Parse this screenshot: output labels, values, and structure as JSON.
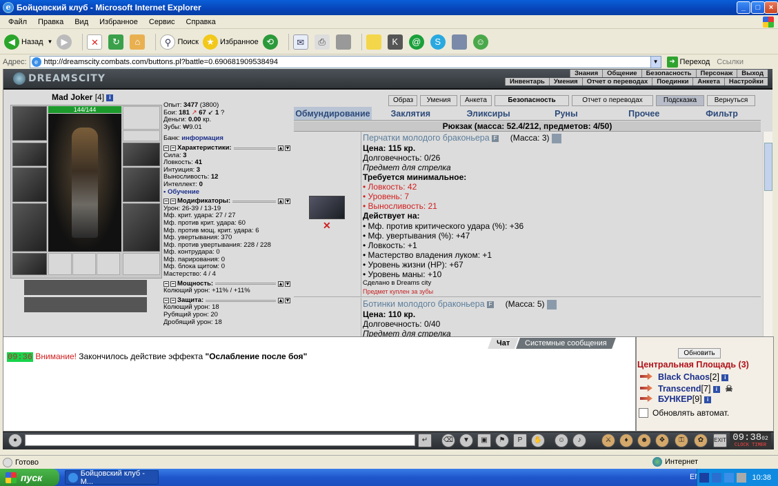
{
  "window": {
    "title": "Бойцовский клуб - Microsoft Internet Explorer"
  },
  "menu": [
    "Файл",
    "Правка",
    "Вид",
    "Избранное",
    "Сервис",
    "Справка"
  ],
  "toolbar": {
    "back": "Назад",
    "search": "Поиск",
    "favorites": "Избранное"
  },
  "address": {
    "label": "Адрес:",
    "url": "http://dreamscity.combats.com/buttons.pl?battle=0.690681909538494",
    "go": "Переход",
    "links": "Ссылки"
  },
  "game": {
    "logo": "DREAMSCITY",
    "nav_top": [
      "Знания",
      "Общение",
      "Безопасность",
      "Персонаж",
      "Выход"
    ],
    "nav_bottom": [
      "Инвентарь",
      "Умения",
      "Отчет о переводах",
      "Поединки",
      "Анкета",
      "Настройки"
    ],
    "character": {
      "name": "Mad Joker",
      "level": "[4]",
      "hp": "144/144"
    },
    "buttons": [
      "Образ",
      "Умения",
      "Анкета",
      "Безопасность",
      "Отчет о переводах",
      "Подсказка",
      "Вернуться"
    ],
    "tabs": [
      "Обмундирование",
      "Заклятия",
      "Эликсиры",
      "Руны",
      "Прочее",
      "Фильтр"
    ],
    "backpack": "Рюкзак (масса: 52.4/212, предметов: 4/50)",
    "stats": {
      "exp_label": "Опыт:",
      "exp": "3477",
      "exp_next": "(3800)",
      "fights_label": "Бои:",
      "wins": "181",
      "losses": "67",
      "draws": "1",
      "money_label": "Деньги:",
      "money": "0.00",
      "money_unit": "кр.",
      "teeth_label": "Зубы:",
      "teeth": "₩9.01",
      "bank_label": "Банк:",
      "bank_link": "информация",
      "sec_chars": "Характеристики:",
      "chars": [
        {
          "label": "Сила:",
          "value": "3"
        },
        {
          "label": "Ловкость:",
          "value": "41"
        },
        {
          "label": "Интуиция:",
          "value": "3"
        },
        {
          "label": "Выносливость:",
          "value": "12"
        },
        {
          "label": "Интеллект:",
          "value": "0"
        }
      ],
      "training": "• Обучение",
      "sec_mods": "Модификаторы:",
      "mods": [
        "Урон: 26-39 / 13-19",
        "Мф. крит. удара: 27 / 27",
        "Мф. против крит. удара: 60",
        "Мф. против мощ. крит. удара: 6",
        "Мф. увертывания: 370",
        "Мф. против увертывания: 228 / 228",
        "Мф. контрудара: 0",
        "Мф. парирования: 0",
        "Мф. блока щитом: 0",
        "Мастерство: 4 / 4"
      ],
      "sec_power": "Мощность:",
      "power": [
        "Колющий урон: +11% / +11%"
      ],
      "sec_defense": "Защита:",
      "defense": [
        "Колющий урон: 18",
        "Рубящий урон: 20",
        "Дробящий урон: 18"
      ]
    },
    "items": [
      {
        "name": "Перчатки молодого браконьера",
        "badge": "F",
        "mass": "(Масса: 3)",
        "price": "Цена: 115 кр.",
        "durability": "Долговечность: 0/26",
        "purpose": "Предмет для стрелка",
        "req_title": "Требуется минимальное:",
        "reqs": [
          "• Ловкость: 42",
          "• Уровень: 7",
          "• Выносливость: 21"
        ],
        "acts_title": "Действует на:",
        "acts": [
          "• Мф. против критического удара (%): +36",
          "• Мф. увертывания (%): +47",
          "• Ловкость: +1",
          "• Мастерство владения луком: +1",
          "• Уровень жизни (HP): +67",
          "• Уровень маны: +10"
        ],
        "made": "Сделано в Dreams city",
        "bought": "Предмет куплен за зубы"
      },
      {
        "name": "Ботинки молодого браконьера",
        "badge": "F",
        "mass": "(Масса: 5)",
        "price": "Цена: 110 кр.",
        "durability": "Долговечность: 0/40",
        "purpose": "Предмет для стрелка"
      }
    ]
  },
  "chat": {
    "tabs": [
      "Чат",
      "Системные сообщения"
    ],
    "time": "09:36",
    "warning": "Внимание!",
    "text": " Закончилось действие эффекта ",
    "effect": "\"Ослабление после боя\""
  },
  "room": {
    "refresh": "Обновить",
    "location": "Центральная Площадь (3)",
    "players": [
      {
        "name": "Black Chaos",
        "level": "[2]"
      },
      {
        "name": "Transcend",
        "level": "[7]"
      },
      {
        "name": "БУНКЕР",
        "level": "[9]"
      }
    ],
    "auto": "Обновлять автомат."
  },
  "clock": {
    "time": "09:38",
    "sec": "02",
    "labels": "CLOCK TIMER"
  },
  "status": {
    "done": "Готово",
    "zone": "Интернет"
  },
  "taskbar": {
    "start": "пуск",
    "item": "Бойцовский клуб - M...",
    "lang": "EN",
    "time": "10:38"
  }
}
